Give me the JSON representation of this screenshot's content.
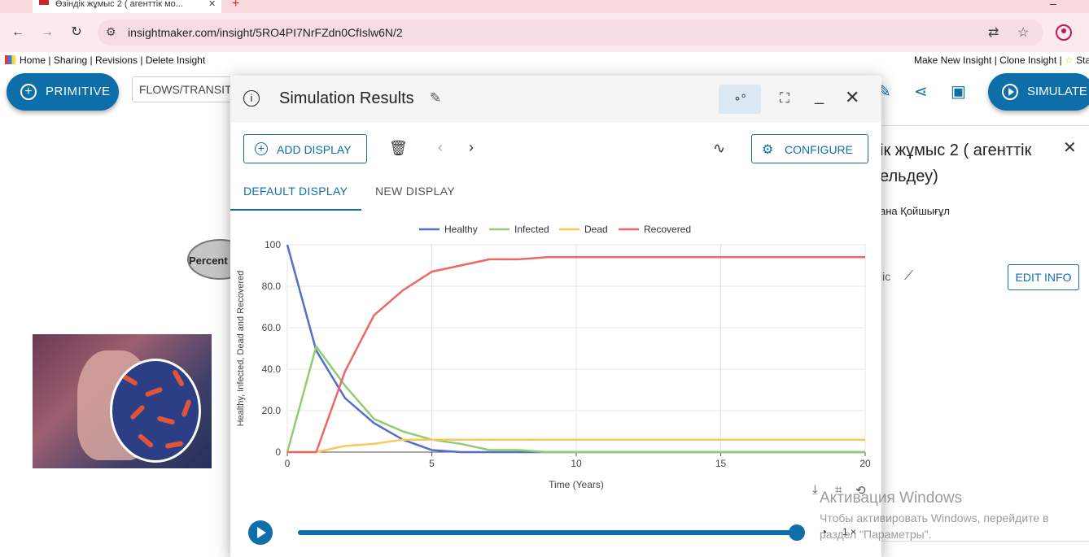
{
  "browser": {
    "tab_title": "Өзіндік жұмыс 2 ( агенттік мо...",
    "url": "insightmaker.com/insight/5RO4PI7NrFZdn0CfIslw6N/2"
  },
  "im_nav": {
    "left_links": [
      "Home",
      "Sharing",
      "Revisions",
      "Delete Insight"
    ],
    "right_links": [
      "Make New Insight",
      "Clone Insight",
      "Sta"
    ]
  },
  "toolbar": {
    "primitive_label": "PRIMITIVE",
    "flows_label": "FLOWS/TRANSITI",
    "simulate_label": "SIMULATE"
  },
  "canvas": {
    "node_label": "Percent"
  },
  "info_panel": {
    "title": "ік жұмыс 2 ( агенттік ельдеу)",
    "author": "ана Қойшығұл",
    "visibility": "lic",
    "edit_label": "EDIT INFO"
  },
  "sim": {
    "title": "Simulation Results",
    "add_display_label": "ADD DISPLAY",
    "configure_label": "CONFIGURE",
    "tabs": [
      "DEFAULT DISPLAY",
      "NEW DISPLAY"
    ],
    "speed": "1 ×"
  },
  "chart_data": {
    "type": "line",
    "title": "",
    "xlabel": "Time (Years)",
    "ylabel": "Healthy, Infected, Dead and Recovered",
    "xlim": [
      0,
      20
    ],
    "ylim": [
      0,
      100
    ],
    "xticks": [
      "0",
      "5",
      "10",
      "15",
      "20"
    ],
    "yticks": [
      "0",
      "20.0",
      "40.0",
      "60.0",
      "80.0",
      "100"
    ],
    "legend_position": "top",
    "grid": true,
    "x": [
      0,
      1,
      2,
      3,
      4,
      5,
      6,
      7,
      8,
      9,
      10,
      11,
      12,
      13,
      14,
      15,
      16,
      17,
      18,
      19,
      20
    ],
    "series": [
      {
        "name": "Healthy",
        "color": "#5470c6",
        "values": [
          100,
          49,
          26,
          14,
          6,
          1,
          0,
          0,
          0,
          0,
          0,
          0,
          0,
          0,
          0,
          0,
          0,
          0,
          0,
          0,
          0
        ]
      },
      {
        "name": "Infected",
        "color": "#91cc75",
        "values": [
          0,
          51,
          32,
          16,
          10,
          6,
          4,
          1,
          1,
          0,
          0,
          0,
          0,
          0,
          0,
          0,
          0,
          0,
          0,
          0,
          0
        ]
      },
      {
        "name": "Dead",
        "color": "#fac858",
        "values": [
          0,
          0,
          3,
          4,
          6,
          6,
          6,
          6,
          6,
          6,
          6,
          6,
          6,
          6,
          6,
          6,
          6,
          6,
          6,
          6,
          6
        ]
      },
      {
        "name": "Recovered",
        "color": "#ee6666",
        "values": [
          0,
          0,
          39,
          66,
          78,
          87,
          90,
          93,
          93,
          94,
          94,
          94,
          94,
          94,
          94,
          94,
          94,
          94,
          94,
          94,
          94
        ]
      }
    ]
  },
  "watermark": {
    "title": "Активация Windows",
    "subtitle": "Чтобы активировать Windows, перейдите в раздел \"Параметры\"."
  }
}
